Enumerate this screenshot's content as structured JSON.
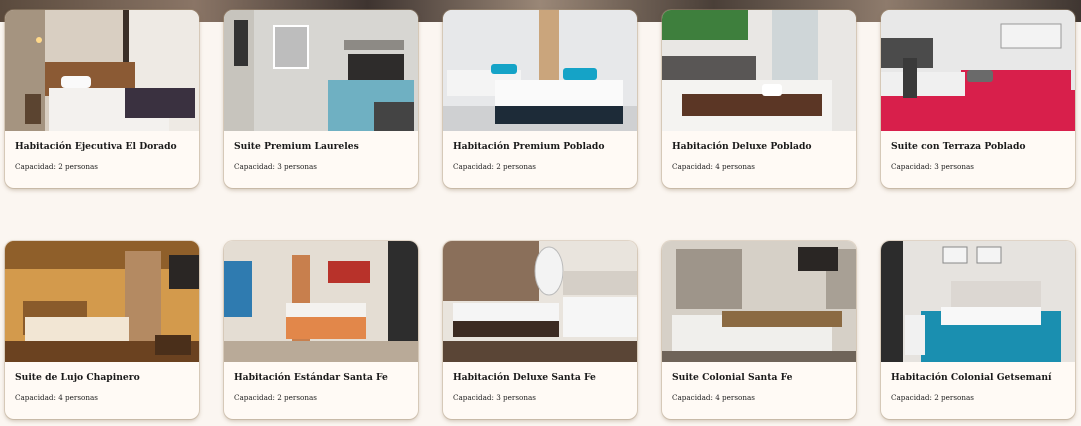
{
  "rooms": [
    {
      "name": "Habitación Ejecutiva El Dorado",
      "capacity": "Capacidad: 2 personas"
    },
    {
      "name": "Suite Premium Laureles",
      "capacity": "Capacidad: 3 personas"
    },
    {
      "name": "Habitación Premium Poblado",
      "capacity": "Capacidad: 2 personas"
    },
    {
      "name": "Habitación Deluxe Poblado",
      "capacity": "Capacidad: 4 personas"
    },
    {
      "name": "Suite con Terraza Poblado",
      "capacity": "Capacidad: 3 personas"
    },
    {
      "name": "Suite de Lujo Chapinero",
      "capacity": "Capacidad: 4 personas"
    },
    {
      "name": "Habitación Estándar Santa Fe",
      "capacity": "Capacidad: 2 personas"
    },
    {
      "name": "Habitación Deluxe Santa Fe",
      "capacity": "Capacidad: 3 personas"
    },
    {
      "name": "Suite Colonial Santa Fe",
      "capacity": "Capacidad: 4 personas"
    },
    {
      "name": "Habitación Colonial Getsemaní",
      "capacity": "Capacidad: 2 personas"
    }
  ]
}
